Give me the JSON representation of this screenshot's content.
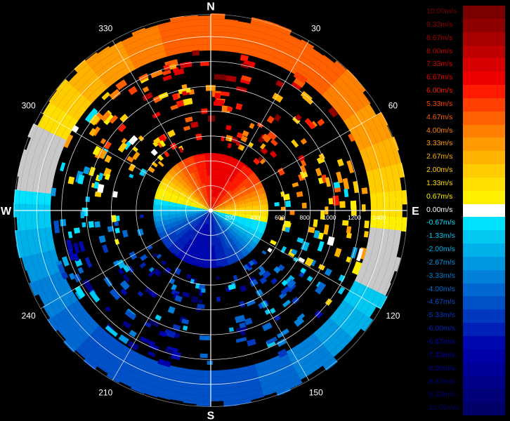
{
  "chart_data": {
    "type": "polar-radar",
    "title": "",
    "cardinals": [
      "N",
      "E",
      "S",
      "W"
    ],
    "azimuth_ticks": [
      "30",
      "60",
      "120",
      "150",
      "210",
      "240",
      "300",
      "330"
    ],
    "range_ticks": [
      "200",
      "400",
      "600",
      "800",
      "1000",
      "1200",
      "1400"
    ],
    "range_max": 1500,
    "grid": true,
    "color_scale": {
      "unit": "m/s",
      "labels": [
        "10.00m/s",
        "9.33m/s",
        "8.67m/s",
        "8.00m/s",
        "7.33m/s",
        "6.67m/s",
        "6.00m/s",
        "5.33m/s",
        "4.67m/s",
        "4.00m/s",
        "3.33m/s",
        "2.67m/s",
        "2.00m/s",
        "1.33m/s",
        "0.67m/s",
        "0.00m/s",
        "-0.67m/s",
        "-1.33m/s",
        "-2.00m/s",
        "-2.67m/s",
        "-3.33m/s",
        "-4.00m/s",
        "-4.67m/s",
        "-5.33m/s",
        "-6.00m/s",
        "-6.67m/s",
        "-7.33m/s",
        "-8.00m/s",
        "-8.67m/s",
        "-9.33m/s",
        "-10.00m/s"
      ],
      "colors": [
        "#7a0000",
        "#8f0000",
        "#a80000",
        "#c00000",
        "#d80000",
        "#ee0000",
        "#ff1a00",
        "#ff4000",
        "#ff6000",
        "#ff8000",
        "#ff9a00",
        "#ffb300",
        "#ffcc00",
        "#ffdf00",
        "#fff000",
        "#ffffff",
        "#00e0ff",
        "#00c8f0",
        "#00b0e8",
        "#0098e0",
        "#0080d8",
        "#0068d0",
        "#0050c8",
        "#0038c0",
        "#0020b8",
        "#0008b0",
        "#0000a8",
        "#000098",
        "#000088",
        "#000078",
        "#000068"
      ]
    }
  }
}
